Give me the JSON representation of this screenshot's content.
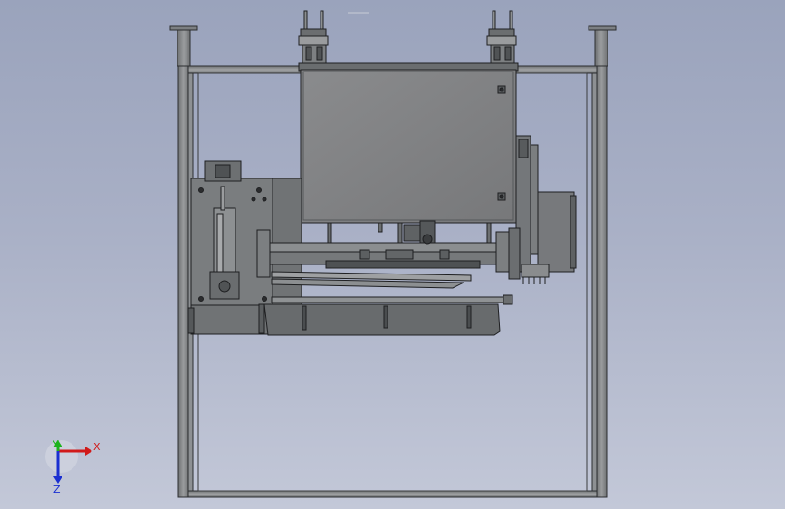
{
  "viewport": {
    "background_top": "#9aa3bc",
    "background_bottom": "#c3c8d8"
  },
  "triad": {
    "x_label": "X",
    "y_label": "Y",
    "z_label": "Z",
    "x_color": "#d11a1a",
    "y_color": "#1db31d",
    "z_color": "#1a2fd1"
  },
  "model": {
    "frame_color": "#7f8285",
    "panel_color": "#808183",
    "dark_part_color": "#5f6264"
  }
}
